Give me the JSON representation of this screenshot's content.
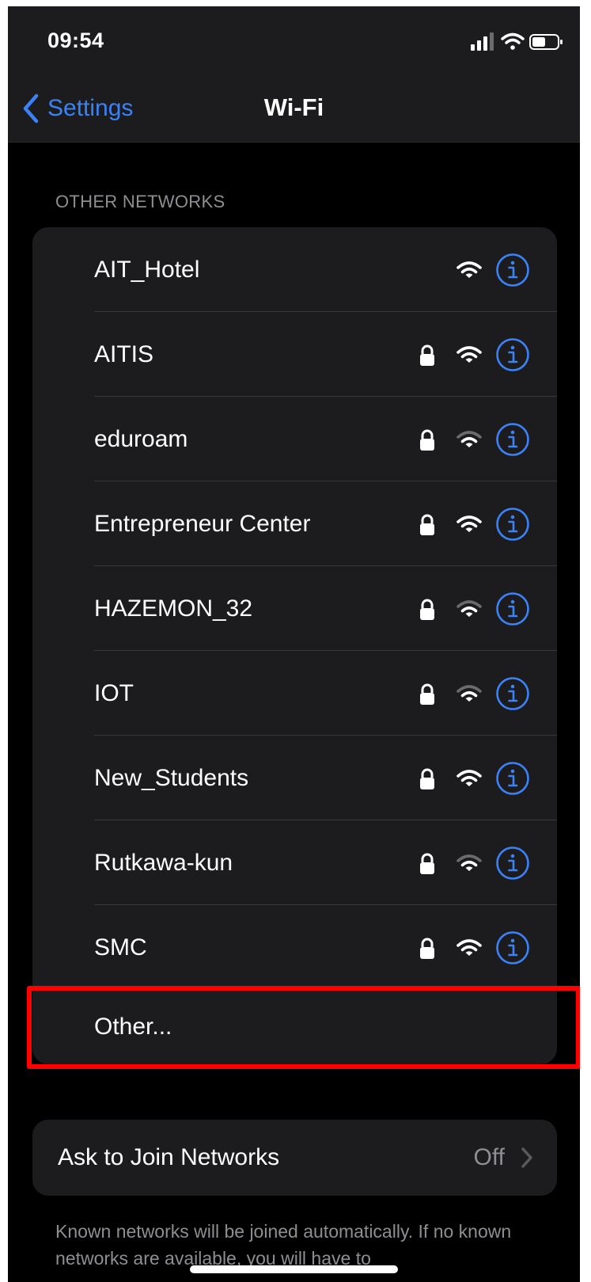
{
  "status_bar": {
    "time": "09:54"
  },
  "nav": {
    "back_label": "Settings",
    "title": "Wi-Fi"
  },
  "section_header": "OTHER NETWORKS",
  "networks": [
    {
      "name": "AIT_Hotel",
      "locked": false,
      "signal": 3
    },
    {
      "name": "AITIS",
      "locked": true,
      "signal": 3
    },
    {
      "name": "eduroam",
      "locked": true,
      "signal": 2
    },
    {
      "name": "Entrepreneur Center",
      "locked": true,
      "signal": 3
    },
    {
      "name": "HAZEMON_32",
      "locked": true,
      "signal": 2
    },
    {
      "name": "IOT",
      "locked": true,
      "signal": 2
    },
    {
      "name": "New_Students",
      "locked": true,
      "signal": 3
    },
    {
      "name": "Rutkawa-kun",
      "locked": true,
      "signal": 2
    },
    {
      "name": "SMC",
      "locked": true,
      "signal": 3
    }
  ],
  "other_label": "Other...",
  "ask_to_join": {
    "label": "Ask to Join Networks",
    "value": "Off"
  },
  "footer_note": "Known networks will be joined automatically. If no known networks are available, you will have to",
  "colors": {
    "accent": "#3b82f6",
    "background": "#000000",
    "card": "#1c1c1e",
    "highlight": "#ff0000"
  },
  "icons": {
    "back": "chevron-left-icon",
    "lock": "lock-icon",
    "wifi": "wifi-icon",
    "info": "info-icon",
    "chevron": "chevron-right-icon"
  }
}
